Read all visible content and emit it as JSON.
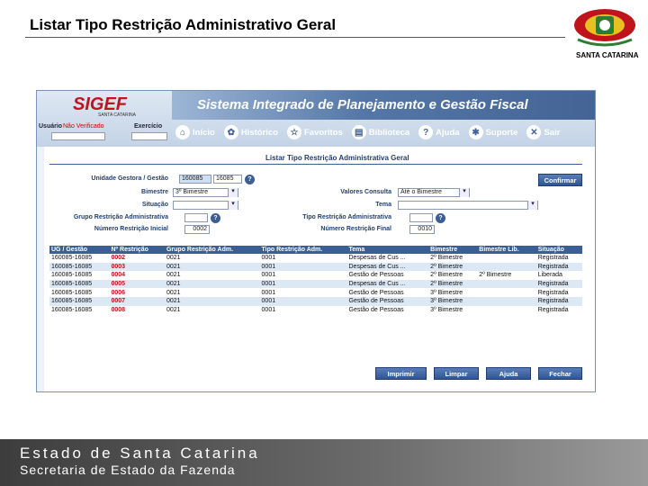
{
  "slide": {
    "title": "Listar Tipo Restrição Administrativo Geral",
    "logo_caption": "SANTA CATARINA",
    "footer_line1": "Estado de Santa Catarina",
    "footer_line2": "Secretaria de Estado da Fazenda"
  },
  "app": {
    "brand": "SIGEF",
    "brand_sub": "SANTA CATARINA",
    "banner": "Sistema Integrado de Planejamento e Gestão Fiscal",
    "user_label": "Usuário",
    "user_value": "Não Verificado",
    "exercise_label": "Exercício",
    "nav": [
      {
        "label": "Início",
        "icon": "home-icon",
        "glyph": "⌂"
      },
      {
        "label": "Histórico",
        "icon": "history-icon",
        "glyph": "✿"
      },
      {
        "label": "Favoritos",
        "icon": "star-icon",
        "glyph": "☆"
      },
      {
        "label": "Biblioteca",
        "icon": "book-icon",
        "glyph": "▤"
      },
      {
        "label": "Ajuda",
        "icon": "help-icon",
        "glyph": "?"
      },
      {
        "label": "Suporte",
        "icon": "support-icon",
        "glyph": "✱"
      },
      {
        "label": "Sair",
        "icon": "exit-icon",
        "glyph": "✕"
      }
    ]
  },
  "form": {
    "section_title": "Listar Tipo Restrição Administrativa Geral",
    "unidade_label": "Unidade Gestora / Gestão",
    "unidade_value1": "160085",
    "unidade_value2": "16085",
    "bimestre_label": "Bimestre",
    "bimestre_value": "3º Bimestre",
    "situacao_label": "Situação",
    "situacao_value": "",
    "grupo_label": "Grupo Restrição Administrativa",
    "grupo_value": "",
    "num_inicial_label": "Número Restrição Inicial",
    "num_inicial_value": "0002",
    "valores_label": "Valores Consulta",
    "valores_value": "Até o Bimestre",
    "tema_label": "Tema",
    "tema_value": "",
    "tipo_label": "Tipo Restrição Administrativa",
    "tipo_value": "",
    "num_final_label": "Número Restrição Final",
    "num_final_value": "0010",
    "confirm_label": "Confirmar"
  },
  "table": {
    "headers": [
      "UG / Gestão",
      "Nº Restrição",
      "Grupo Restrição Adm.",
      "Tipo Restrição Adm.",
      "Tema",
      "Bimestre",
      "Bimestre Lib.",
      "Situação"
    ],
    "rows": [
      [
        "160085-16085",
        "0002",
        "0021",
        "0001",
        "Despesas de Cus ...",
        "2º Bimestre",
        "",
        "Registrada"
      ],
      [
        "160085-16085",
        "0003",
        "0021",
        "0001",
        "Despesas de Cus ...",
        "2º Bimestre",
        "",
        "Registrada"
      ],
      [
        "160085-16085",
        "0004",
        "0021",
        "0001",
        "Gestão de Pessoas",
        "2º Bimestre",
        "2º Bimestre",
        "Liberada"
      ],
      [
        "160085-16085",
        "0005",
        "0021",
        "0001",
        "Despesas de Cus ...",
        "2º Bimestre",
        "",
        "Registrada"
      ],
      [
        "160085-16085",
        "0006",
        "0021",
        "0001",
        "Gestão de Pessoas",
        "3º Bimestre",
        "",
        "Registrada"
      ],
      [
        "160085-16085",
        "0007",
        "0021",
        "0001",
        "Gestão de Pessoas",
        "3º Bimestre",
        "",
        "Registrada"
      ],
      [
        "160085-16085",
        "0008",
        "0021",
        "0001",
        "Gestão de Pessoas",
        "3º Bimestre",
        "",
        "Registrada"
      ]
    ]
  },
  "buttons": {
    "imprimir": "Imprimir",
    "limpar": "Limpar",
    "ajuda": "Ajuda",
    "fechar": "Fechar"
  },
  "colors": {
    "accent": "#3b5f95",
    "brand_red": "#c0141d"
  }
}
